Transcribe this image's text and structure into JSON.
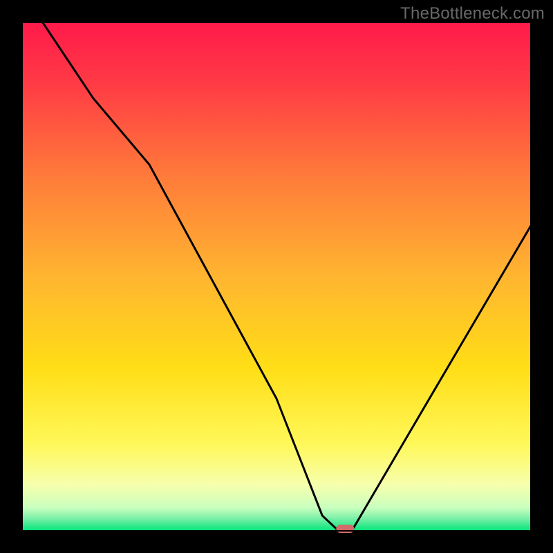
{
  "watermark": "TheBottleneck.com",
  "chart_data": {
    "type": "line",
    "title": "",
    "xlabel": "",
    "ylabel": "",
    "xlim": [
      0,
      100
    ],
    "ylim": [
      0,
      100
    ],
    "x": [
      4,
      14,
      25,
      50,
      59,
      62.2,
      64.8,
      100
    ],
    "values": [
      100,
      85,
      72,
      26,
      3,
      0,
      0,
      60
    ],
    "minimum_marker": {
      "x": 63.5,
      "y": 0
    },
    "colors": {
      "gradient_top": "#ff1a4a",
      "gradient_mid": "#ffd900",
      "gradient_low": "#faffb8",
      "gradient_bottom": "#00e57a",
      "marker": "#d46a6a",
      "curve": "#000000",
      "frame": "#000000"
    }
  }
}
